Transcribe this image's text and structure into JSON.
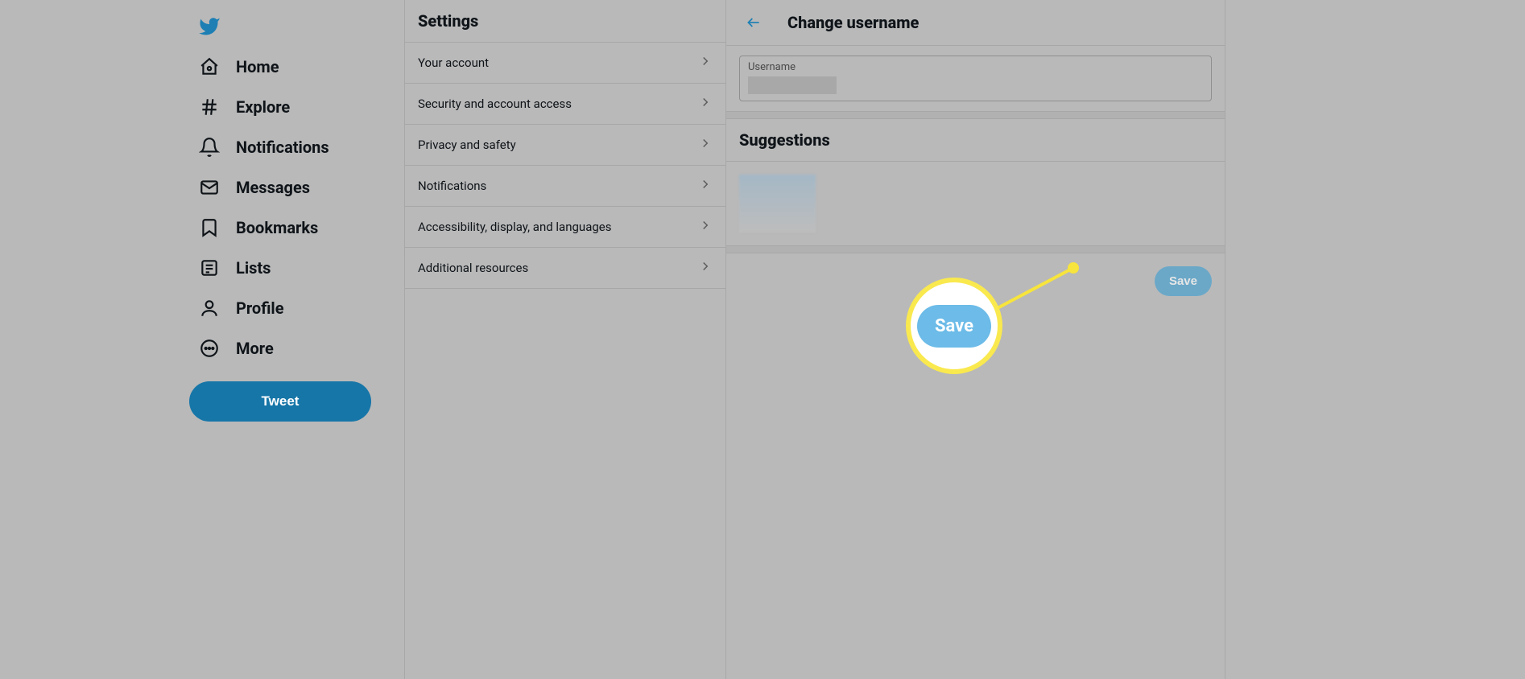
{
  "nav": {
    "items": [
      {
        "label": "Home"
      },
      {
        "label": "Explore"
      },
      {
        "label": "Notifications"
      },
      {
        "label": "Messages"
      },
      {
        "label": "Bookmarks"
      },
      {
        "label": "Lists"
      },
      {
        "label": "Profile"
      },
      {
        "label": "More"
      }
    ],
    "tweet_label": "Tweet"
  },
  "settings": {
    "title": "Settings",
    "items": [
      {
        "label": "Your account"
      },
      {
        "label": "Security and account access"
      },
      {
        "label": "Privacy and safety"
      },
      {
        "label": "Notifications"
      },
      {
        "label": "Accessibility, display, and languages"
      },
      {
        "label": "Additional resources"
      }
    ]
  },
  "detail": {
    "title": "Change username",
    "username_label": "Username",
    "suggestions_title": "Suggestions",
    "save_label": "Save"
  },
  "callout": {
    "label": "Save"
  }
}
